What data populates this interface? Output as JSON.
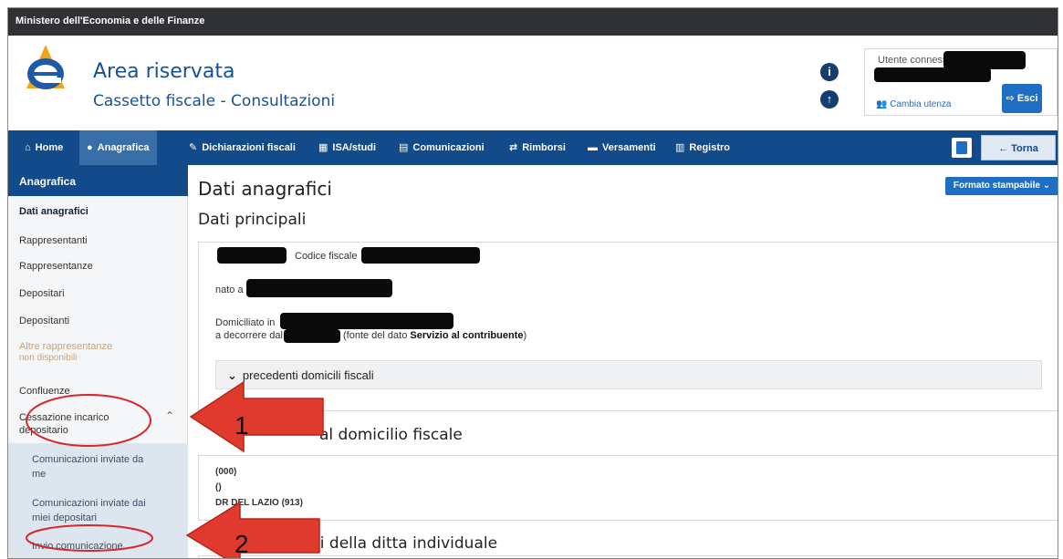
{
  "ministry": "Ministero dell'Economia e delle Finanze",
  "header": {
    "title": "Area riservata",
    "subtitle": "Cassetto fiscale - Consultazioni",
    "user_label": "Utente connesso:",
    "switch_user": "Cambia utenza",
    "logout": "Esci"
  },
  "nav": {
    "items": [
      {
        "label": "Home",
        "icon": "home-icon"
      },
      {
        "label": "Anagrafica",
        "icon": "users-icon"
      },
      {
        "label": "Dichiarazioni fiscali",
        "icon": "edit-icon"
      },
      {
        "label": "ISA/studi",
        "icon": "calculator-icon"
      },
      {
        "label": "Comunicazioni",
        "icon": "document-icon"
      },
      {
        "label": "Rimborsi",
        "icon": "refund-icon"
      },
      {
        "label": "Versamenti",
        "icon": "payments-icon"
      },
      {
        "label": "Registro",
        "icon": "registry-icon"
      }
    ],
    "back": "← Torna"
  },
  "sidebar": {
    "header": "Anagrafica",
    "items": [
      "Dati anagrafici",
      "Rappresentanti",
      "Rappresentanze",
      "Depositari",
      "Depositanti",
      "Altre rappresentanze",
      "non disponibili",
      "Confluenze",
      "Cessazione incarico",
      "depositario"
    ],
    "subitems": [
      "Comunicazioni inviate da",
      "me",
      "Comunicazioni inviate dai",
      "miei depositari",
      "Invio comunicazione"
    ]
  },
  "main": {
    "title": "Dati anagrafici",
    "print_format": "Formato stampabile",
    "section1": "Dati principali",
    "codice_fiscale": "Codice fiscale",
    "nato_a": "nato a",
    "domiciliato_in": "Domiciliato in",
    "a_decorrere_dal": "a decorrere dal",
    "fonte_pre": "(fonte del dato ",
    "fonte_bold": "Servizio al contribuente",
    "fonte_post": ")",
    "accordion": "precedenti domicili fiscali",
    "section2_part": "al domicilio fiscale",
    "office_code": "(000)",
    "office_paren": "()",
    "office_name": "DR DEL LAZIO (913)",
    "section3_part": "ivi della ditta individuale"
  },
  "annotations": {
    "arrow1": "1",
    "arrow2": "2",
    "arrow_color": "#e03a2e",
    "circle_color": "#d8262b"
  }
}
